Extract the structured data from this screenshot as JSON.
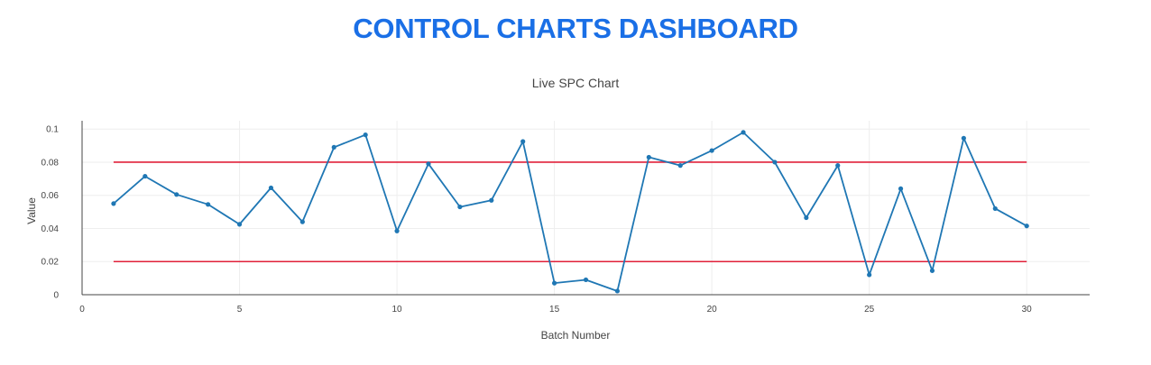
{
  "dashboard": {
    "title": "CONTROL CHARTS DASHBOARD"
  },
  "colors": {
    "title": "#1a6fe6",
    "series": "#1f77b4",
    "control_limits": "#e0203a",
    "grid": "#eeeeee"
  },
  "chart_data": {
    "type": "line",
    "title": "Live SPC Chart",
    "xlabel": "Batch Number",
    "ylabel": "Value",
    "xlim": [
      0,
      32
    ],
    "ylim": [
      0,
      0.105
    ],
    "xticks": [
      0,
      5,
      10,
      15,
      20,
      25,
      30
    ],
    "xtick_labels": [
      "0",
      "5",
      "10",
      "15",
      "20",
      "25",
      "30"
    ],
    "yticks": [
      0,
      0.02,
      0.04,
      0.06,
      0.08,
      0.1
    ],
    "ytick_labels": [
      "0",
      "0.02",
      "0.04",
      "0.06",
      "0.08",
      "0.1"
    ],
    "grid": true,
    "legend": "none",
    "series": [
      {
        "x": [
          1,
          2,
          3,
          4,
          5,
          6,
          7,
          8,
          9,
          10,
          11,
          12,
          13,
          14,
          15,
          16,
          17,
          18,
          19,
          20,
          21,
          22,
          23,
          24,
          25,
          26,
          27,
          28,
          29,
          30
        ],
        "y": [
          0.055,
          0.0715,
          0.0605,
          0.0545,
          0.0425,
          0.0645,
          0.044,
          0.089,
          0.0965,
          0.0385,
          0.079,
          0.053,
          0.057,
          0.0925,
          0.007,
          0.009,
          0.0022,
          0.083,
          0.078,
          0.087,
          0.098,
          0.08,
          0.0465,
          0.078,
          0.012,
          0.064,
          0.0145,
          0.0945,
          0.052,
          0.0415
        ]
      }
    ],
    "control_limits": [
      {
        "value": 0.08,
        "x": [
          1,
          30
        ]
      },
      {
        "value": 0.02,
        "x": [
          1,
          30
        ]
      }
    ]
  }
}
